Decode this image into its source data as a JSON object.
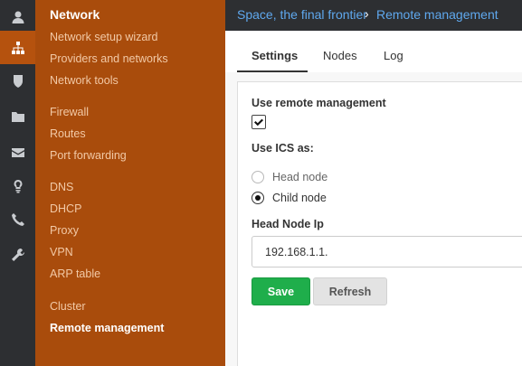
{
  "sidebar": {
    "icons": [
      {
        "name": "user-icon",
        "active": false
      },
      {
        "name": "network-icon",
        "active": true
      },
      {
        "name": "shield-icon",
        "active": false
      },
      {
        "name": "folder-icon",
        "active": false
      },
      {
        "name": "envelope-icon",
        "active": false
      },
      {
        "name": "lightbulb-icon",
        "active": false
      },
      {
        "name": "phone-icon",
        "active": false
      },
      {
        "name": "wrench-icon",
        "active": false
      }
    ],
    "title": "Network",
    "items": [
      {
        "label": "Network setup wizard"
      },
      {
        "label": "Providers and networks"
      },
      {
        "label": "Network tools"
      },
      {
        "label": "Firewall"
      },
      {
        "label": "Routes"
      },
      {
        "label": "Port forwarding"
      },
      {
        "label": "DNS"
      },
      {
        "label": "DHCP"
      },
      {
        "label": "Proxy"
      },
      {
        "label": "VPN"
      },
      {
        "label": "ARP table"
      },
      {
        "label": "Cluster"
      },
      {
        "label": "Remote management"
      }
    ],
    "active_item": "Remote management"
  },
  "header": {
    "breadcrumb_root": "Space, the final frontier",
    "breadcrumb_separator": "›",
    "breadcrumb_current": "Remote management"
  },
  "tabs": [
    {
      "label": "Settings",
      "active": true
    },
    {
      "label": "Nodes",
      "active": false
    },
    {
      "label": "Log",
      "active": false
    }
  ],
  "form": {
    "use_remote_label": "Use remote management",
    "use_remote_checked": true,
    "ics_label": "Use ICS as:",
    "ics_options": [
      {
        "label": "Head node",
        "selected": false
      },
      {
        "label": "Child node",
        "selected": true
      }
    ],
    "head_node_ip_label": "Head Node Ip",
    "head_node_ip_value": "192.168.1.1.",
    "save_label": "Save",
    "refresh_label": "Refresh"
  },
  "colors": {
    "accent_orange": "#a94c0c",
    "rail_dark": "#2d2f32",
    "breadcrumb_blue": "#5fa8ee",
    "save_green": "#1fae4b"
  }
}
